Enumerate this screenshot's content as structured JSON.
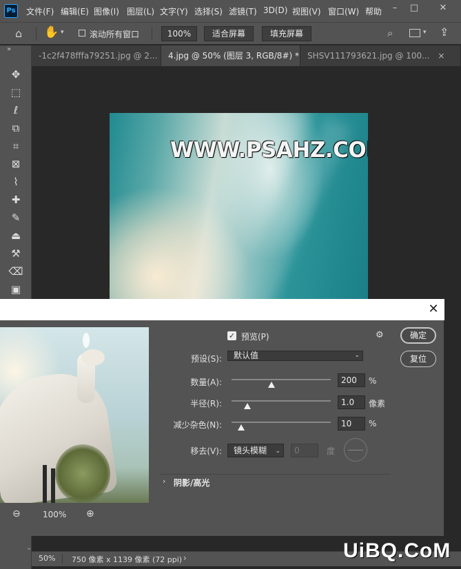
{
  "app": {
    "logo": "Ps"
  },
  "menu": [
    "文件(F)",
    "编辑(E)",
    "图像(I)",
    "图层(L)",
    "文字(Y)",
    "选择(S)",
    "滤镜(T)",
    "3D(D)",
    "视图(V)",
    "窗口(W)",
    "帮助"
  ],
  "window_controls": [
    "–",
    "□",
    "✕"
  ],
  "options": {
    "scroll_all_label": "滚动所有窗口",
    "zoom": "100%",
    "fit_screen": "适合屏幕",
    "fill_screen": "填充屏幕"
  },
  "tabs": [
    {
      "label": "-1c2f478fffa79251.jpg @ 2...",
      "close": "×"
    },
    {
      "label": "4.jpg @ 50% (图层 3, RGB/8#) *",
      "close": "×"
    },
    {
      "label": "SHSV111793621.jpg @ 100...",
      "close": "×"
    }
  ],
  "canvas": {
    "watermark": "WWW.PSAHZ.COM"
  },
  "dialog": {
    "close": "✕",
    "preview_label": "预览(P)",
    "preview_checked": true,
    "ok": "确定",
    "reset": "复位",
    "preset_label": "预设(S):",
    "preset_value": "默认值",
    "amount_label": "数量(A):",
    "amount_value": "200",
    "amount_unit": "%",
    "amount_level": 0.4,
    "radius_label": "半径(R):",
    "radius_value": "1.0",
    "radius_unit": "像素",
    "radius_level": 0.16,
    "noise_label": "减少杂色(N):",
    "noise_value": "10",
    "noise_unit": "%",
    "noise_level": 0.1,
    "remove_label": "移去(V):",
    "remove_value": "镜头模糊",
    "angle_value": "0",
    "angle_unit": "度",
    "shadow_section": "阴影/高光",
    "zoom_value": "100%"
  },
  "status": {
    "zoom": "50%",
    "doc_info": "750 像素 x 1139 像素 (72 ppi)",
    "arrow": "›"
  },
  "brand": "UiBQ.CoM"
}
